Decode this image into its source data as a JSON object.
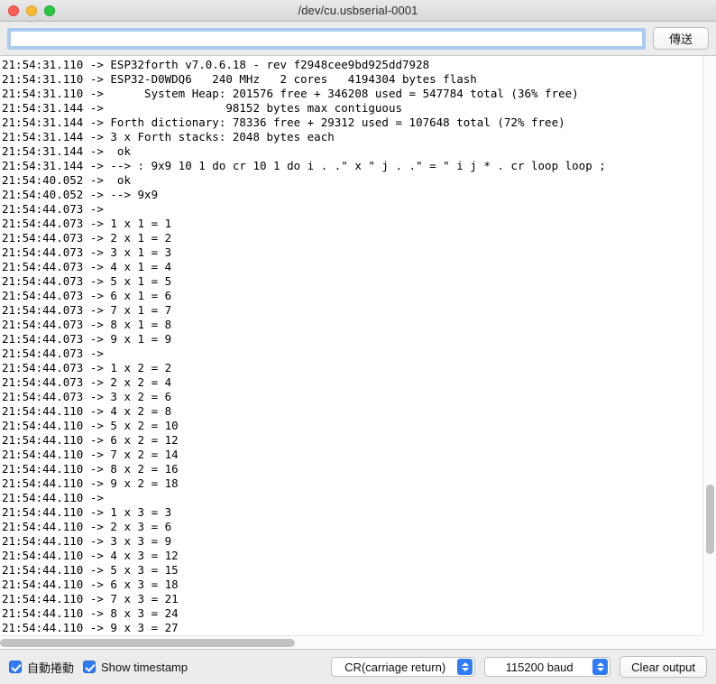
{
  "window": {
    "title": "/dev/cu.usbserial-0001",
    "traffic_lights": [
      "close-button",
      "minimize-button",
      "maximize-button"
    ]
  },
  "input_row": {
    "value": "",
    "placeholder": "",
    "send_label": "傳送"
  },
  "terminal": {
    "lines": [
      "21:54:31.110 -> ESP32forth v7.0.6.18 - rev f2948cee9bd925dd7928",
      "21:54:31.110 -> ESP32-D0WDQ6   240 MHz   2 cores   4194304 bytes flash",
      "21:54:31.110 ->      System Heap: 201576 free + 346208 used = 547784 total (36% free)",
      "21:54:31.144 ->                  98152 bytes max contiguous",
      "21:54:31.144 -> Forth dictionary: 78336 free + 29312 used = 107648 total (72% free)",
      "21:54:31.144 -> 3 x Forth stacks: 2048 bytes each",
      "21:54:31.144 ->  ok",
      "21:54:31.144 -> --> : 9x9 10 1 do cr 10 1 do i . .\" x \" j . .\" = \" i j * . cr loop loop ;",
      "21:54:40.052 ->  ok",
      "21:54:40.052 -> --> 9x9",
      "21:54:44.073 ->",
      "21:54:44.073 -> 1 x 1 = 1",
      "21:54:44.073 -> 2 x 1 = 2",
      "21:54:44.073 -> 3 x 1 = 3",
      "21:54:44.073 -> 4 x 1 = 4",
      "21:54:44.073 -> 5 x 1 = 5",
      "21:54:44.073 -> 6 x 1 = 6",
      "21:54:44.073 -> 7 x 1 = 7",
      "21:54:44.073 -> 8 x 1 = 8",
      "21:54:44.073 -> 9 x 1 = 9",
      "21:54:44.073 ->",
      "21:54:44.073 -> 1 x 2 = 2",
      "21:54:44.073 -> 2 x 2 = 4",
      "21:54:44.073 -> 3 x 2 = 6",
      "21:54:44.110 -> 4 x 2 = 8",
      "21:54:44.110 -> 5 x 2 = 10",
      "21:54:44.110 -> 6 x 2 = 12",
      "21:54:44.110 -> 7 x 2 = 14",
      "21:54:44.110 -> 8 x 2 = 16",
      "21:54:44.110 -> 9 x 2 = 18",
      "21:54:44.110 ->",
      "21:54:44.110 -> 1 x 3 = 3",
      "21:54:44.110 -> 2 x 3 = 6",
      "21:54:44.110 -> 3 x 3 = 9",
      "21:54:44.110 -> 4 x 3 = 12",
      "21:54:44.110 -> 5 x 3 = 15",
      "21:54:44.110 -> 6 x 3 = 18",
      "21:54:44.110 -> 7 x 3 = 21",
      "21:54:44.110 -> 8 x 3 = 24",
      "21:54:44.110 -> 9 x 3 = 27"
    ],
    "vscroll_thumb_top_pct": 74,
    "vscroll_thumb_height_pct": 12,
    "hscroll_thumb_left_pct": 0,
    "hscroll_thumb_width_pct": 42
  },
  "bottom_bar": {
    "autoscroll_label": "自動捲動",
    "autoscroll_checked": true,
    "timestamp_label": "Show timestamp",
    "timestamp_checked": true,
    "line_ending_value": "CR(carriage return)",
    "baud_value": "115200 baud",
    "clear_label": "Clear output"
  },
  "colors": {
    "accent": "#2f7cf6",
    "window_bg": "#ececec",
    "terminal_bg": "#ffffff",
    "terminal_text": "#000000"
  }
}
